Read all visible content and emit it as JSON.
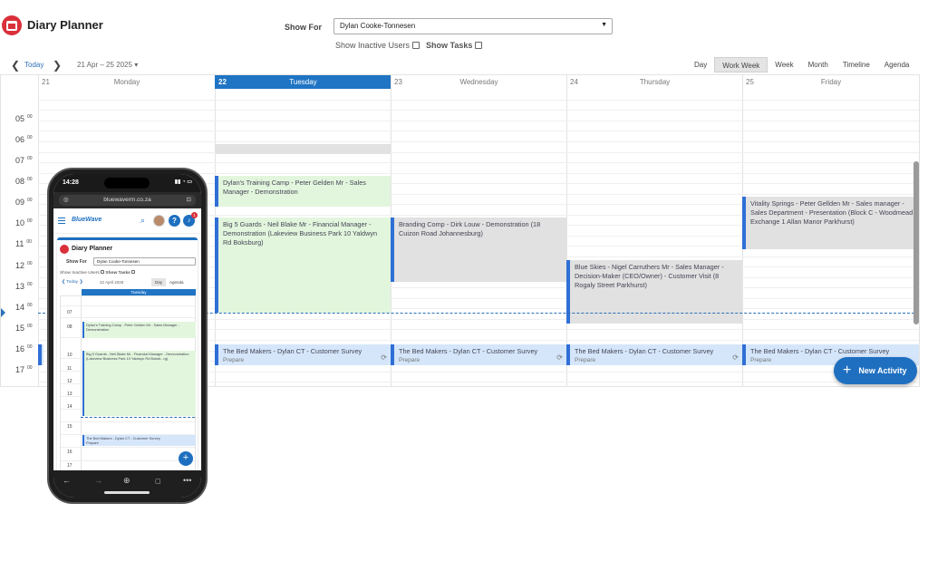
{
  "header": {
    "title": "Diary Planner",
    "show_for_label": "Show For",
    "selected_user": "Dylan Cooke-Tonnesen",
    "show_inactive_label": "Show Inactive Users",
    "show_tasks_label": "Show Tasks"
  },
  "toolbar": {
    "today_label": "Today",
    "date_range": "21 Apr – 25 2025",
    "views": [
      "Day",
      "Work Week",
      "Week",
      "Month",
      "Timeline",
      "Agenda"
    ],
    "active_view": "Work Week"
  },
  "days": [
    {
      "num": "21",
      "name": "Monday"
    },
    {
      "num": "22",
      "name": "Tuesday",
      "today": true
    },
    {
      "num": "23",
      "name": "Wednesday"
    },
    {
      "num": "24",
      "name": "Thursday"
    },
    {
      "num": "25",
      "name": "Friday"
    }
  ],
  "hours": [
    "05",
    "06",
    "07",
    "08",
    "09",
    "10",
    "11",
    "12",
    "13",
    "14",
    "15",
    "16",
    "17"
  ],
  "minute_label": "00",
  "events": {
    "e1": "Dylan's Training Camp - Peter Gelden Mr - Sales Manager - Demonstration",
    "e2": "Big 5 Guards - Neil Blake Mr - Financial Manager - Demonstration (Lakeview Business Park 10 Yaldwyn Rd Boksburg)",
    "e3": "Branding Comp - Dirk Louw - Demonstration (18 Cuizon Road Johannesburg)",
    "e4": "Blue Skies - Nigel Carruthers Mr - Sales Manager - Decision-Maker (CEO/Owner) - Customer Visit (8 Rogaly Street Parkhurst)",
    "e5": "Vitality Springs - Peter Gellden Mr - Sales manager - Sales Department - Presentation (Block C - Woodmead Exchange 1 Allan Manor Parkhurst)",
    "survey": "The Bed Makers - Dylan CT - Customer Survey",
    "survey_sub": "Prepare"
  },
  "fab_label": "New Activity",
  "colors": {
    "accent": "#1e6fc0",
    "today_header": "#1f74c4",
    "brand_red": "#d9303a",
    "event_green": "#e2f6dd",
    "event_gray": "#e1e1e1",
    "event_blue": "#d5e6fa"
  },
  "phone": {
    "time": "14:28",
    "url": "bluewaverm.co.za",
    "logo": "BlueWave",
    "notification_count": "1",
    "title": "Diary Planner",
    "show_for_label": "Show For",
    "selected_user": "Dylan Cooke-Tonnesen",
    "show_inactive_label": "Show Inactive Users",
    "show_tasks_label": "Show Tasks",
    "today_label": "Today",
    "date": "22 April 2025",
    "views": [
      "Day",
      "Agenda"
    ],
    "day_name": "Tuesday",
    "hours": [
      "07",
      "08",
      "10",
      "11",
      "12",
      "13",
      "14",
      "15",
      "16",
      "17"
    ],
    "e1": "Dylan's Training Camp - Peter Gelden Mr - Sales Manager - Demonstration",
    "e2": "Big 5 Guards - Neil Blake Mr - Financial Manager - Demonstration (Lakeview Business Park 10 Yaldwyn Rd Boksb...rg)",
    "e3": "The Bed Makers - Dylan CT - Customer Survey",
    "e3_sub": "Prepare"
  }
}
